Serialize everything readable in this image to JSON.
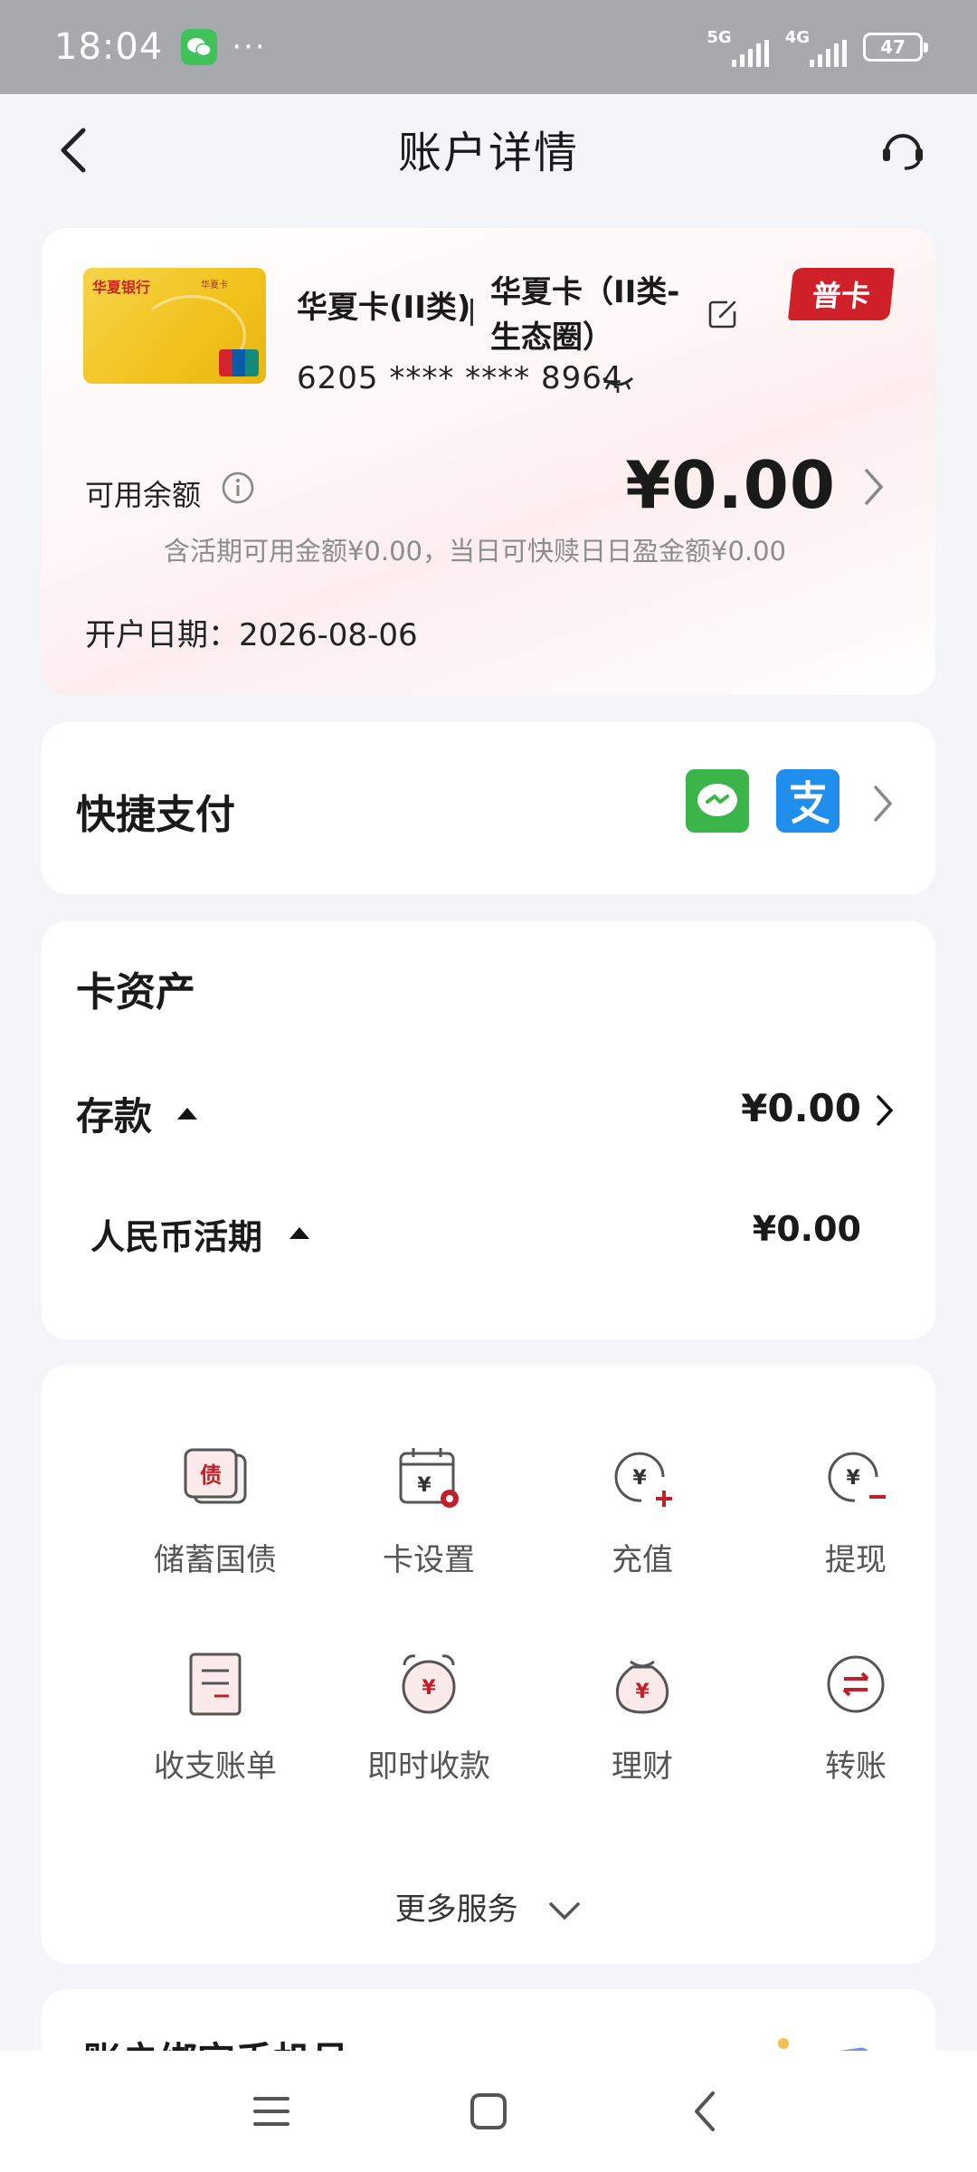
{
  "status_bar": {
    "time": "18:04",
    "net1": "5G",
    "net2": "4G",
    "battery": "47"
  },
  "header": {
    "title": "账户详情"
  },
  "account": {
    "card_name": "华夏卡(II类)",
    "card_nickname": "华夏卡（II类-生态圈）",
    "badge": "普卡",
    "card_number": "6205 **** **** 8964",
    "card_logo_text": "华夏银行",
    "card_logo_sub": "华夏卡",
    "balance_label": "可用余额",
    "balance": "¥0.00",
    "balance_note": "含活期可用金额¥0.00，当日可快赎日日盈金额¥0.00",
    "open_date": "开户日期：2026-08-06"
  },
  "quick_pay": {
    "title": "快捷支付"
  },
  "assets": {
    "title": "卡资产",
    "deposit_label": "存款",
    "deposit_amount": "¥0.00",
    "rmb_label": "人民币活期",
    "rmb_amount": "¥0.00"
  },
  "services": {
    "items": [
      {
        "label": "储蓄国债",
        "icon": "bond-icon"
      },
      {
        "label": "卡设置",
        "icon": "card-settings-icon"
      },
      {
        "label": "充值",
        "icon": "top-up-icon"
      },
      {
        "label": "提现",
        "icon": "withdraw-icon"
      },
      {
        "label": "收支账单",
        "icon": "statement-icon"
      },
      {
        "label": "即时收款",
        "icon": "instant-receive-icon"
      },
      {
        "label": "理财",
        "icon": "wealth-icon"
      },
      {
        "label": "转账",
        "icon": "transfer-icon"
      }
    ],
    "more_label": "更多服务"
  },
  "bind_phone": {
    "title": "账户绑定手机号"
  },
  "colors": {
    "accent": "#d0202a",
    "wechat": "#3bb54a",
    "alipay": "#1f8eed",
    "background": "#f4f5f9"
  }
}
